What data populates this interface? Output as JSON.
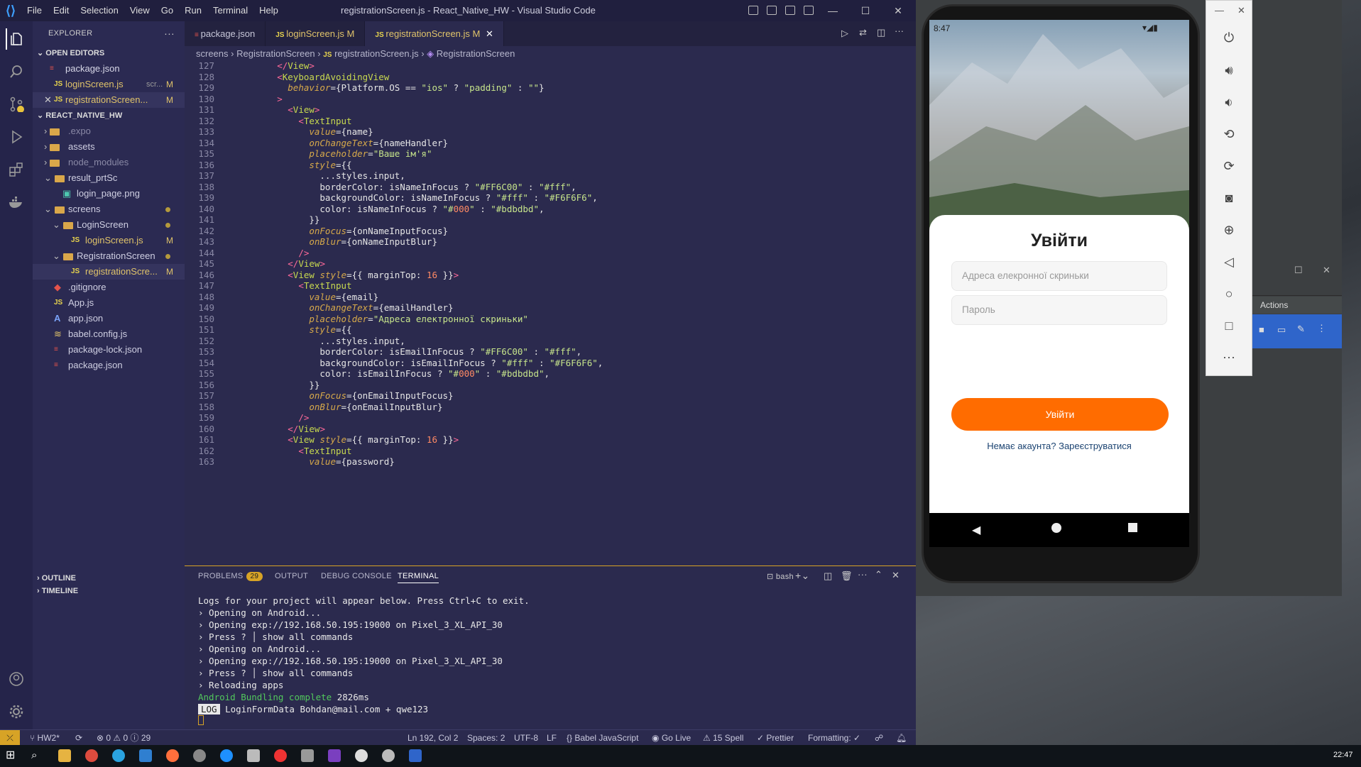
{
  "titlebar": {
    "menu": [
      "File",
      "Edit",
      "Selection",
      "View",
      "Go",
      "Run",
      "Terminal",
      "Help"
    ],
    "title": "registrationScreen.js - React_Native_HW - Visual Studio Code"
  },
  "explorer": {
    "header": "EXPLORER",
    "open_editors_label": "OPEN EDITORS",
    "open_editors": [
      {
        "name": "package.json",
        "status": ""
      },
      {
        "name": "loginScreen.js",
        "hint": "scr...",
        "status": "M"
      },
      {
        "name": "registrationScreen...",
        "status": "M"
      }
    ],
    "project_label": "REACT_NATIVE_HW",
    "tree": [
      {
        "name": ".expo",
        "indent": 1,
        "kind": "folder"
      },
      {
        "name": "assets",
        "indent": 1,
        "kind": "folder"
      },
      {
        "name": "node_modules",
        "indent": 1,
        "kind": "folder"
      },
      {
        "name": "result_prtSc",
        "indent": 1,
        "kind": "folder-open"
      },
      {
        "name": "login_page.png",
        "indent": 2,
        "kind": "image"
      },
      {
        "name": "screens",
        "indent": 1,
        "kind": "folder-open"
      },
      {
        "name": "LoginScreen",
        "indent": 2,
        "kind": "folder-open"
      },
      {
        "name": "loginScreen.js",
        "indent": 3,
        "kind": "js",
        "status": "M"
      },
      {
        "name": "RegistrationScreen",
        "indent": 2,
        "kind": "folder-open"
      },
      {
        "name": "registrationScre...",
        "indent": 3,
        "kind": "js",
        "status": "M"
      },
      {
        "name": ".gitignore",
        "indent": 1,
        "kind": "git"
      },
      {
        "name": "App.js",
        "indent": 1,
        "kind": "js"
      },
      {
        "name": "app.json",
        "indent": 1,
        "kind": "expo"
      },
      {
        "name": "babel.config.js",
        "indent": 1,
        "kind": "babel"
      },
      {
        "name": "package-lock.json",
        "indent": 1,
        "kind": "npm"
      },
      {
        "name": "package.json",
        "indent": 1,
        "kind": "npm"
      }
    ],
    "outline_label": "OUTLINE",
    "timeline_label": "TIMELINE"
  },
  "tabs": [
    {
      "name": "package.json",
      "status": ""
    },
    {
      "name": "loginScreen.js",
      "status": "M"
    },
    {
      "name": "registrationScreen.js",
      "status": "M"
    }
  ],
  "breadcrumb": [
    "screens",
    "RegistrationScreen",
    "registrationScreen.js",
    "RegistrationScreen"
  ],
  "code_lines": [
    {
      "n": "127",
      "t": "        </View>"
    },
    {
      "n": "128",
      "t": "        <KeyboardAvoidingView"
    },
    {
      "n": "129",
      "t": "          behavior={Platform.OS == \"ios\" ? \"padding\" : \"\"}"
    },
    {
      "n": "130",
      "t": "        >"
    },
    {
      "n": "131",
      "t": "          <View>"
    },
    {
      "n": "132",
      "t": "            <TextInput"
    },
    {
      "n": "133",
      "t": "              value={name}"
    },
    {
      "n": "134",
      "t": "              onChangeText={nameHandler}"
    },
    {
      "n": "135",
      "t": "              placeholder=\"Ваше ім'я\""
    },
    {
      "n": "136",
      "t": "              style={{"
    },
    {
      "n": "137",
      "t": "                ...styles.input,"
    },
    {
      "n": "138",
      "t": "                borderColor: isNameInFocus ? \"#FF6C00\" : \"#fff\","
    },
    {
      "n": "139",
      "t": "                backgroundColor: isNameInFocus ? \"#fff\" : \"#F6F6F6\","
    },
    {
      "n": "140",
      "t": "                color: isNameInFocus ? \"#000\" : \"#bdbdbd\","
    },
    {
      "n": "141",
      "t": "              }}"
    },
    {
      "n": "142",
      "t": "              onFocus={onNameInputFocus}"
    },
    {
      "n": "143",
      "t": "              onBlur={onNameInputBlur}"
    },
    {
      "n": "144",
      "t": "            />"
    },
    {
      "n": "145",
      "t": "          </View>"
    },
    {
      "n": "146",
      "t": "          <View style={{ marginTop: 16 }}>"
    },
    {
      "n": "147",
      "t": "            <TextInput"
    },
    {
      "n": "148",
      "t": "              value={email}"
    },
    {
      "n": "149",
      "t": "              onChangeText={emailHandler}"
    },
    {
      "n": "150",
      "t": "              placeholder=\"Адреса електронної скриньки\""
    },
    {
      "n": "151",
      "t": "              style={{"
    },
    {
      "n": "152",
      "t": "                ...styles.input,"
    },
    {
      "n": "153",
      "t": "                borderColor: isEmailInFocus ? \"#FF6C00\" : \"#fff\","
    },
    {
      "n": "154",
      "t": "                backgroundColor: isEmailInFocus ? \"#fff\" : \"#F6F6F6\","
    },
    {
      "n": "155",
      "t": "                color: isEmailInFocus ? \"#000\" : \"#bdbdbd\","
    },
    {
      "n": "156",
      "t": "              }}"
    },
    {
      "n": "157",
      "t": "              onFocus={onEmailInputFocus}"
    },
    {
      "n": "158",
      "t": "              onBlur={onEmailInputBlur}"
    },
    {
      "n": "159",
      "t": "            />"
    },
    {
      "n": "160",
      "t": "          </View>"
    },
    {
      "n": "161",
      "t": "          <View style={{ marginTop: 16 }}>"
    },
    {
      "n": "162",
      "t": "            <TextInput"
    },
    {
      "n": "163",
      "t": "              value={password}"
    }
  ],
  "panel": {
    "tabs": [
      "PROBLEMS",
      "OUTPUT",
      "DEBUG CONSOLE",
      "TERMINAL"
    ],
    "problems_count": "29",
    "shell": "bash",
    "terminal_lines": [
      "Logs for your project will appear below. Press Ctrl+C to exit.",
      "› Opening on Android...",
      "› Opening exp://192.168.50.195:19000 on Pixel_3_XL_API_30",
      "› Press ? │ show all commands",
      "› Opening on Android...",
      "› Opening exp://192.168.50.195:19000 on Pixel_3_XL_API_30",
      "› Press ? │ show all commands",
      "› Reloading apps"
    ],
    "bundling_text": "Android Bundling complete",
    "bundling_time": "2826ms",
    "log_tag": "LOG",
    "log_text": "LoginFormData Bohdan@mail.com + qwe123"
  },
  "statusbar": {
    "branch": "HW2*",
    "errors": "0",
    "warnings": "0",
    "info": "29",
    "position": "Ln 192, Col 2",
    "spaces": "Spaces: 2",
    "encoding": "UTF-8",
    "eol": "LF",
    "language": "Babel JavaScript",
    "golive": "Go Live",
    "spell": "15 Spell",
    "prettier": "Prettier",
    "formatting": "Formatting: ✓"
  },
  "phone": {
    "time": "8:47",
    "title": "Увійти",
    "email_placeholder": "Адреса елекронної скриньки",
    "password_placeholder": "Пароль",
    "button": "Увійти",
    "register_link": "Немає акаунта? Зареєструватися"
  },
  "emulator_actions_label": "Actions",
  "taskbar_time": "22:47",
  "colors": {
    "accent": "#FF6C00",
    "vscode_bg": "#2b2a4e"
  }
}
